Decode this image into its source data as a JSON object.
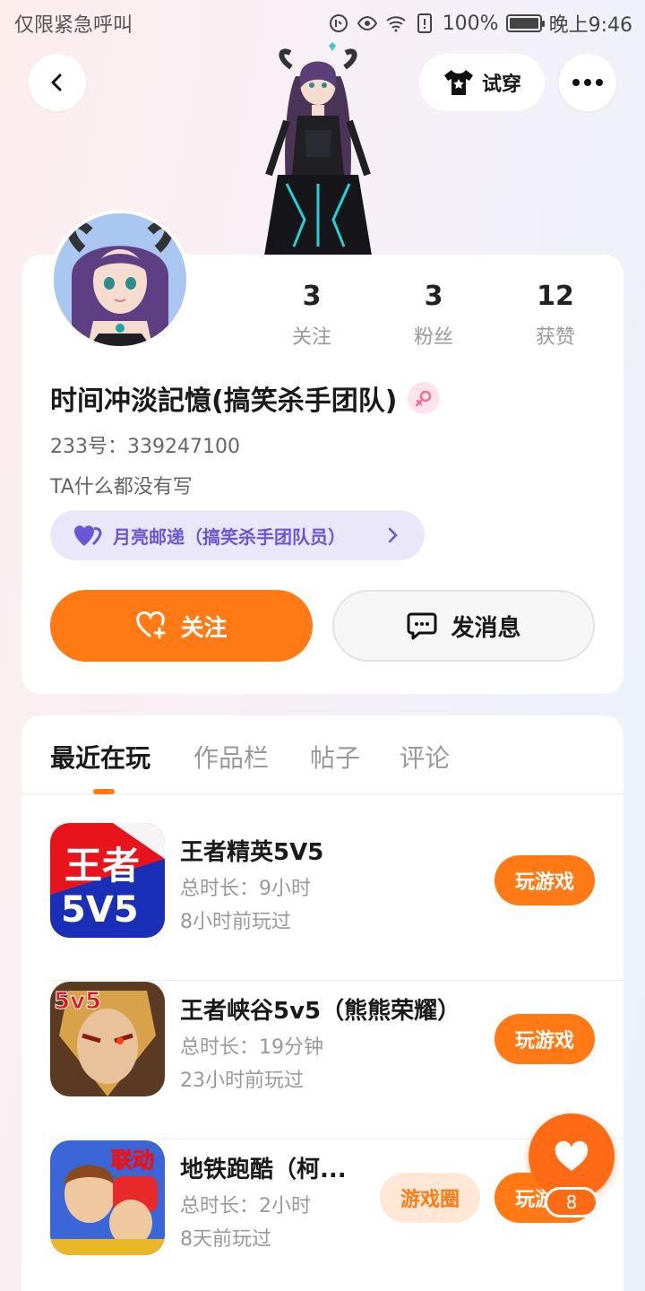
{
  "status_bar": {
    "carrier": "仅限紧急呼叫",
    "battery": "100%",
    "time": "晚上9:46"
  },
  "header": {
    "back_icon": "chevron-left-icon",
    "try_on_label": "试穿",
    "more_icon": "more-dots-icon"
  },
  "profile": {
    "stats": [
      {
        "value": "3",
        "label": "关注"
      },
      {
        "value": "3",
        "label": "粉丝"
      },
      {
        "value": "12",
        "label": "获赞"
      }
    ],
    "nickname": "时间冲淡記憶(搞笑杀手团队)",
    "gender": "female",
    "uid": "233号：339247100",
    "bio": "TA什么都没有写",
    "team_badge": "月亮邮递（搞笑杀手团队员）",
    "follow_label": "关注",
    "message_label": "发消息"
  },
  "tabs": [
    "最近在玩",
    "作品栏",
    "帖子",
    "评论"
  ],
  "active_tab": 0,
  "games": [
    {
      "name": "王者精英5V5",
      "duration": "总时长：9小时",
      "last_played": "8小时前玩过",
      "play_label": "玩游戏"
    },
    {
      "name": "王者峡谷5v5（熊熊荣耀）",
      "duration": "总时长：19分钟",
      "last_played": "23小时前玩过",
      "play_label": "玩游戏"
    },
    {
      "name": "地铁跑酷（柯...",
      "duration": "总时长：2小时",
      "last_played": "8天前玩过",
      "circle_label": "游戏圈",
      "play_label": "玩游戏"
    }
  ],
  "floating_like": {
    "count": "8"
  },
  "colors": {
    "accent": "#ff7a14",
    "badge_purple": "#6b56d8"
  }
}
